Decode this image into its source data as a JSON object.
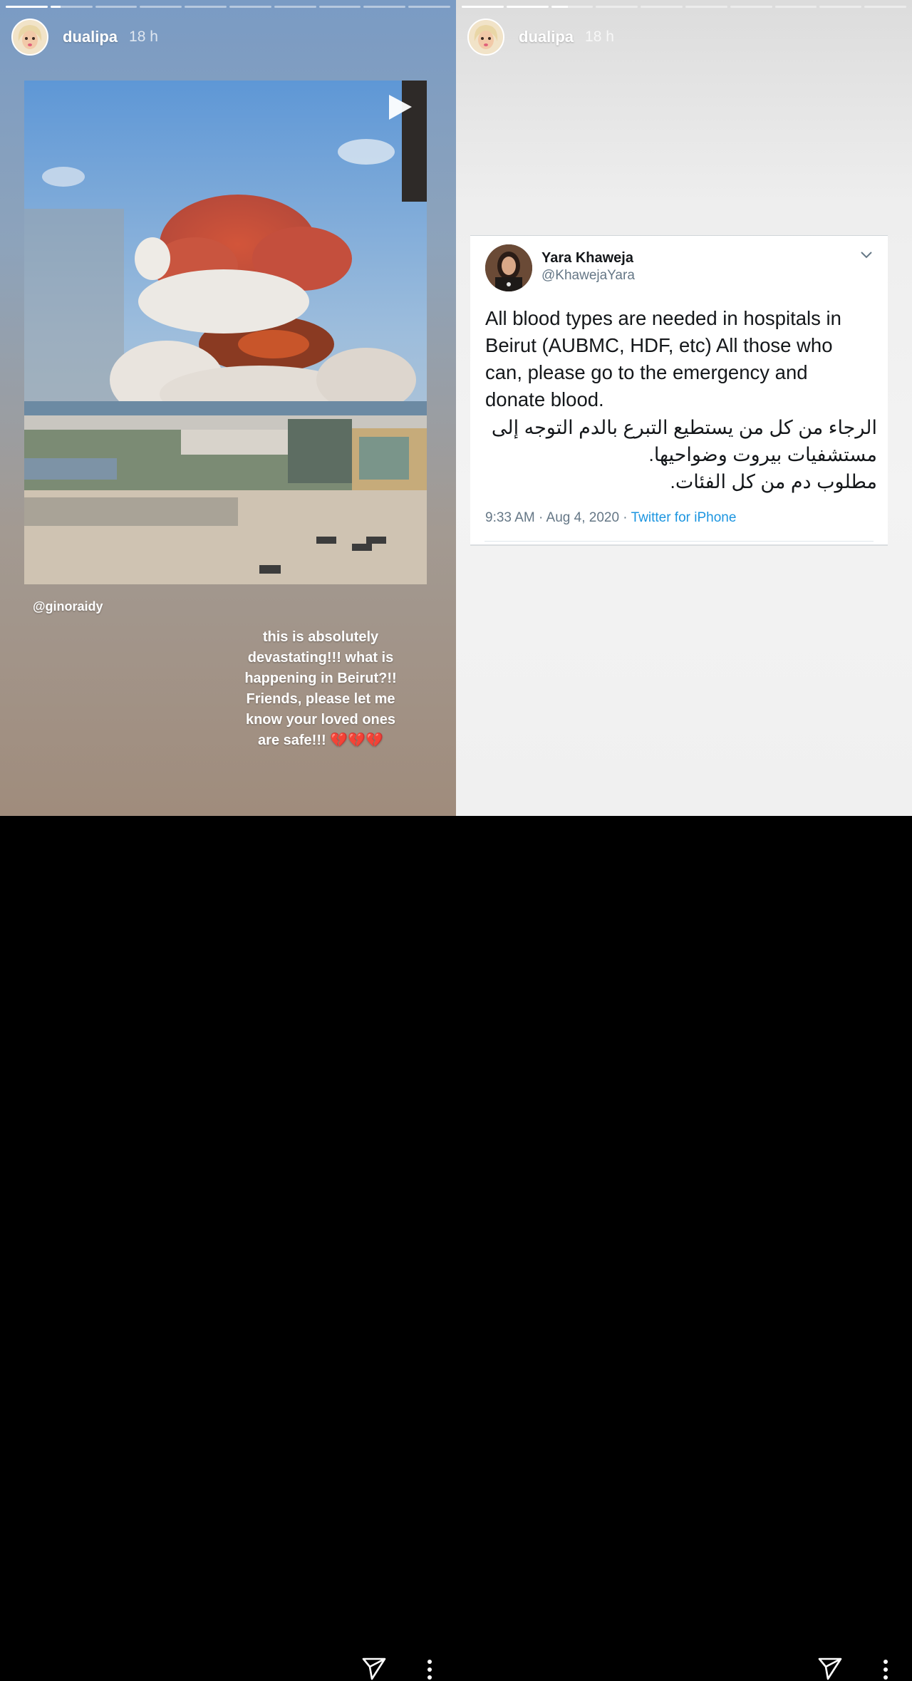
{
  "stories": [
    {
      "username": "dualipa",
      "time": "18 h",
      "progress": {
        "segments": 10,
        "active": 1,
        "active_fill": 0.25
      },
      "mention": "@ginoraidy",
      "caption_lines": [
        "this is absolutely",
        "devastating!!! what is",
        "happening in Beirut?!!",
        "Friends, please let me",
        "know your loved ones"
      ],
      "caption_last": "are safe!!!",
      "caption_emoji": "💔💔💔",
      "media_icon": "play-icon"
    },
    {
      "username": "dualipa",
      "time": "18 h",
      "progress": {
        "segments": 10,
        "active": 2,
        "active_fill": 0.4
      },
      "tweet": {
        "name": "Yara Khaweja",
        "handle": "@KhawejaYara",
        "text_lines": [
          "All blood types are needed in hospitals in",
          "Beirut (AUBMC, HDF, etc) All those who",
          "can, please go to the emergency and",
          "donate blood."
        ],
        "arabic_lines": [
          "الرجاء من كل من يستطيع التبرع بالدم التوجه إلى",
          "مستشفيات بيروت وضواحيها.",
          "مطلوب دم من كل الفئات."
        ],
        "timestamp": "9:33 AM · Aug 4, 2020 · ",
        "source": "Twitter for iPhone"
      }
    }
  ],
  "footer_icons": [
    "send-icon",
    "more-options-icon"
  ],
  "colors": {
    "tweet_link": "#1b95e0",
    "tweet_meta": "#657786",
    "heart": "#d62d3a"
  }
}
